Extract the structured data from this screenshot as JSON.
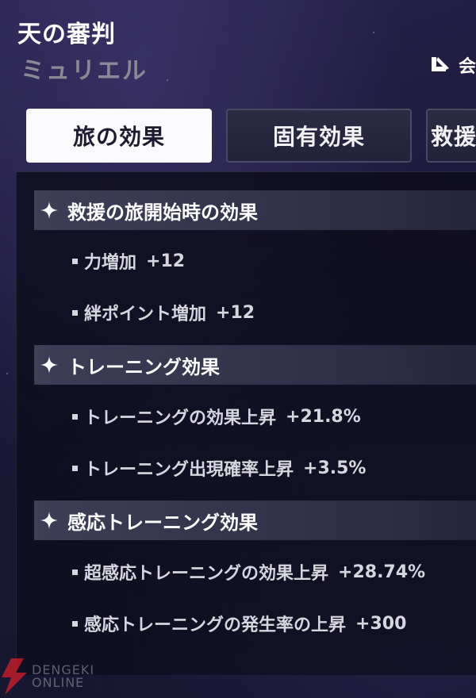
{
  "header": {
    "title": "天の審判",
    "subtitle": "ミュリエル",
    "top_right_label": "会"
  },
  "tabs": [
    {
      "label": "旅の効果",
      "active": true
    },
    {
      "label": "固有効果",
      "active": false
    },
    {
      "label": "救援",
      "active": false
    }
  ],
  "sections": [
    {
      "title": "救援の旅開始時の効果",
      "effects": [
        {
          "label": "力増加",
          "value": "+12"
        },
        {
          "label": "絆ポイント増加",
          "value": "+12"
        }
      ]
    },
    {
      "title": "トレーニング効果",
      "effects": [
        {
          "label": "トレーニングの効果上昇",
          "value": "+21.8%"
        },
        {
          "label": "トレーニング出現確率上昇",
          "value": "+3.5%"
        }
      ]
    },
    {
      "title": "感応トレーニング効果",
      "effects": [
        {
          "label": "超感応トレーニングの効果上昇",
          "value": "+28.74%"
        },
        {
          "label": "感応トレーニングの発生率の上昇",
          "value": "+300"
        }
      ]
    }
  ],
  "watermark": {
    "line1": "DENGEKI",
    "line2": "ONLINE"
  },
  "colors": {
    "background": "#1a1836",
    "tab_active_bg": "#fbfbfd",
    "tab_inactive_bg": "#2c2b44",
    "section_header_bg": "#46465f",
    "watermark_red": "#e0202a"
  }
}
